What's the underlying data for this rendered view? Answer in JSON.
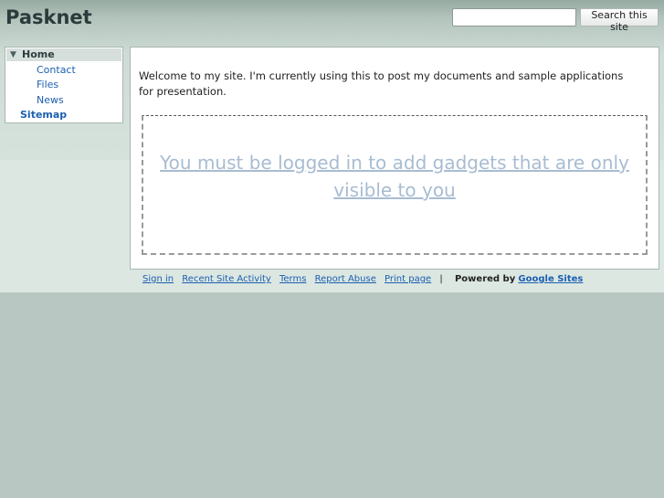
{
  "header": {
    "site_title": "Pasknet",
    "search_placeholder": "",
    "search_button_label": "Search this site"
  },
  "sidebar": {
    "items": [
      {
        "label": "Home",
        "level": 0,
        "expanded": true,
        "selected": true
      },
      {
        "label": "Contact",
        "level": 1
      },
      {
        "label": "Files",
        "level": 1
      },
      {
        "label": "News",
        "level": 1
      },
      {
        "label": "Sitemap",
        "level": 0
      }
    ]
  },
  "main": {
    "welcome_text": "Welcome to my site. I'm currently using this to post my documents and sample applications for presentation.",
    "gadget_message": "You must be logged in to add gadgets that are only visible to you"
  },
  "footer": {
    "links": [
      "Sign in",
      "Recent Site Activity",
      "Terms",
      "Report Abuse",
      "Print page"
    ],
    "separator": "|",
    "powered_by": "Powered by",
    "powered_by_link": "Google Sites"
  },
  "colors": {
    "link": "#1c5fb0",
    "page_background": "#b9c7c2",
    "header_band": "#95aaa1"
  }
}
